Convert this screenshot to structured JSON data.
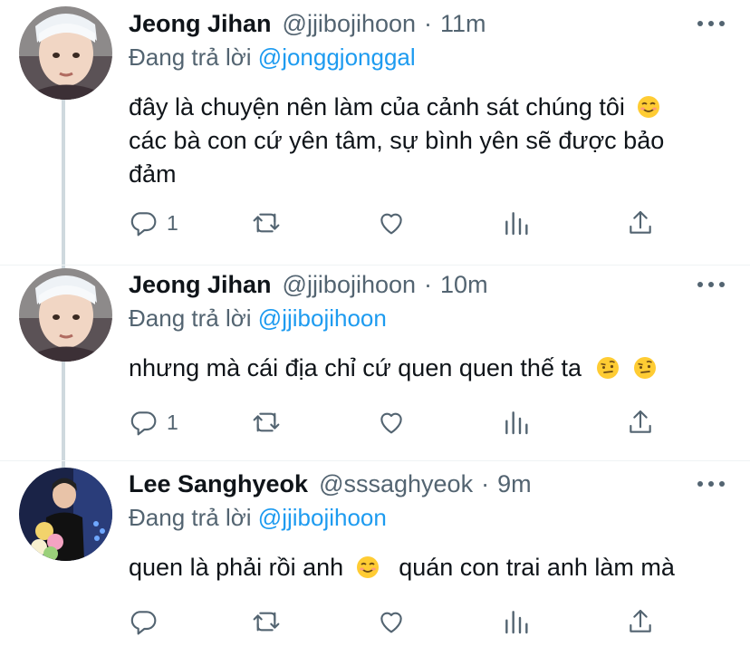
{
  "tweets": [
    {
      "name": "Jeong Jihan",
      "handle": "@jjibojihoon",
      "time": "11m",
      "reply_prefix": "Đang trả lời",
      "reply_to": "@jonggjonggal",
      "text_lines": [
        "đây là chuyện nên làm của cảnh sát chúng tôi",
        "các bà con cứ yên tâm, sự bình yên sẽ được bảo",
        "đảm"
      ],
      "reply_count": "1"
    },
    {
      "name": "Jeong Jihan",
      "handle": "@jjibojihoon",
      "time": "10m",
      "reply_prefix": "Đang trả lời",
      "reply_to": "@jjibojihoon",
      "text_lines": [
        "nhưng mà cái địa chỉ cứ quen quen thế ta"
      ],
      "reply_count": "1"
    },
    {
      "name": "Lee Sanghyeok",
      "handle": "@sssaghyeok",
      "time": "9m",
      "reply_prefix": "Đang trả lời",
      "reply_to": "@jjibojihoon",
      "text_a": "quen là phải rồi anh",
      "text_b": "quán con trai anh làm mà",
      "reply_count": ""
    }
  ],
  "icons": {
    "reply": "reply-icon",
    "retweet": "retweet-icon",
    "like": "like-icon",
    "stats": "stats-icon",
    "share": "share-icon",
    "more": "more-icon",
    "emoji_smile": "smiling-face-emoji",
    "emoji_raised_brow": "raised-eyebrow-emoji"
  },
  "colors": {
    "link": "#1d9bf0",
    "secondary": "#536471",
    "thread_line": "#cfd9de"
  }
}
